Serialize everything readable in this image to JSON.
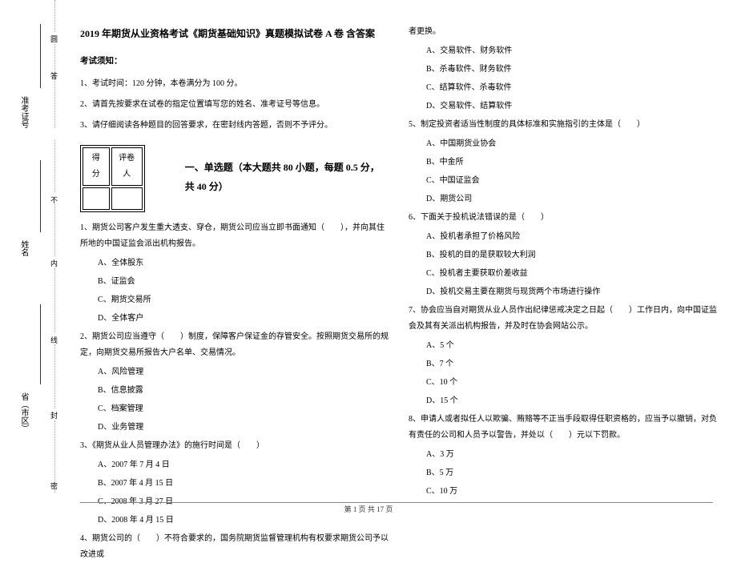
{
  "binding": {
    "markers": [
      "圆",
      "答",
      "不",
      "内",
      "线",
      "封",
      "密"
    ],
    "fields": {
      "ticket": "准考证号",
      "name": "姓名",
      "province": "省（市区）"
    }
  },
  "title": "2019 年期货从业资格考试《期货基础知识》真题模拟试卷 A 卷  含答案",
  "notice_heading": "考试须知：",
  "notices": [
    "1、考试时间：120 分钟，本卷满分为 100 分。",
    "2、请首先按要求在试卷的指定位置填写您的姓名、准考证号等信息。",
    "3、请仔细阅读各种题目的回答要求，在密封线内答题，否则不予评分。"
  ],
  "score_header": {
    "score": "得分",
    "grader": "评卷人"
  },
  "section1_title": "一、单选题（本大题共 80 小题，每题 0.5 分，共 40 分）",
  "q1": {
    "stem": "1、期货公司客户发生重大透支、穿仓，期货公司应当立即书面通知（　　），并向其住所地的中国证监会派出机构报告。",
    "opts": [
      "A、全体股东",
      "B、证监会",
      "C、期货交易所",
      "D、全体客户"
    ]
  },
  "q2": {
    "stem": "2、期货公司应当遵守（　　）制度，保障客户保证金的存管安全。按照期货交易所的规定，向期货交易所报告大户名单、交易情况。",
    "opts": [
      "A、风险管理",
      "B、信息披露",
      "C、档案管理",
      "D、业务管理"
    ]
  },
  "q3": {
    "stem": "3、《期货从业人员管理办法》的施行时间是（　　）",
    "opts": [
      "A、2007 年 7 月 4 日",
      "B、2007 年 4 月 15 日",
      "C、2008 年 3 月 27 日",
      "D、2008 年 4 月 15 日"
    ]
  },
  "q4": {
    "stem_part1": "4、期货公司的（　　）不符合要求的，国务院期货监督管理机构有权要求期货公司予以改进或",
    "stem_part2": "者更换。",
    "opts": [
      "A、交易软件、财务软件",
      "B、杀毒软件、财务软件",
      "C、结算软件、杀毒软件",
      "D、交易软件、结算软件"
    ]
  },
  "q5": {
    "stem": "5、制定投资者适当性制度的具体标准和实施指引的主体是（　　）",
    "opts": [
      "A、中国期货业协会",
      "B、中金所",
      "C、中国证监会",
      "D、期货公司"
    ]
  },
  "q6": {
    "stem": "6、下面关于投机说法错误的是（　　）",
    "opts": [
      "A、投机者承担了价格风险",
      "B、投机的目的是获取较大利润",
      "C、投机者主要获取价差收益",
      "D、投机交易主要在期货与现货两个市场进行操作"
    ]
  },
  "q7": {
    "stem": "7、协会应当自对期货从业人员作出纪律惩戒决定之日起（　　）工作日内，向中国证监会及其有关派出机构报告，并及时在协会网站公示。",
    "opts": [
      "A、5 个",
      "B、7 个",
      "C、10 个",
      "D、15 个"
    ]
  },
  "q8": {
    "stem": "8、申请人或者拟任人以欺骗、贿赂等不正当手段取得任职资格的，应当予以撤销，对负有责任的公司和人员予以警告，并处以（　　）元以下罚款。",
    "opts": [
      "A、3 万",
      "B、5 万",
      "C、10 万"
    ]
  },
  "footer": "第 1 页 共 17 页"
}
